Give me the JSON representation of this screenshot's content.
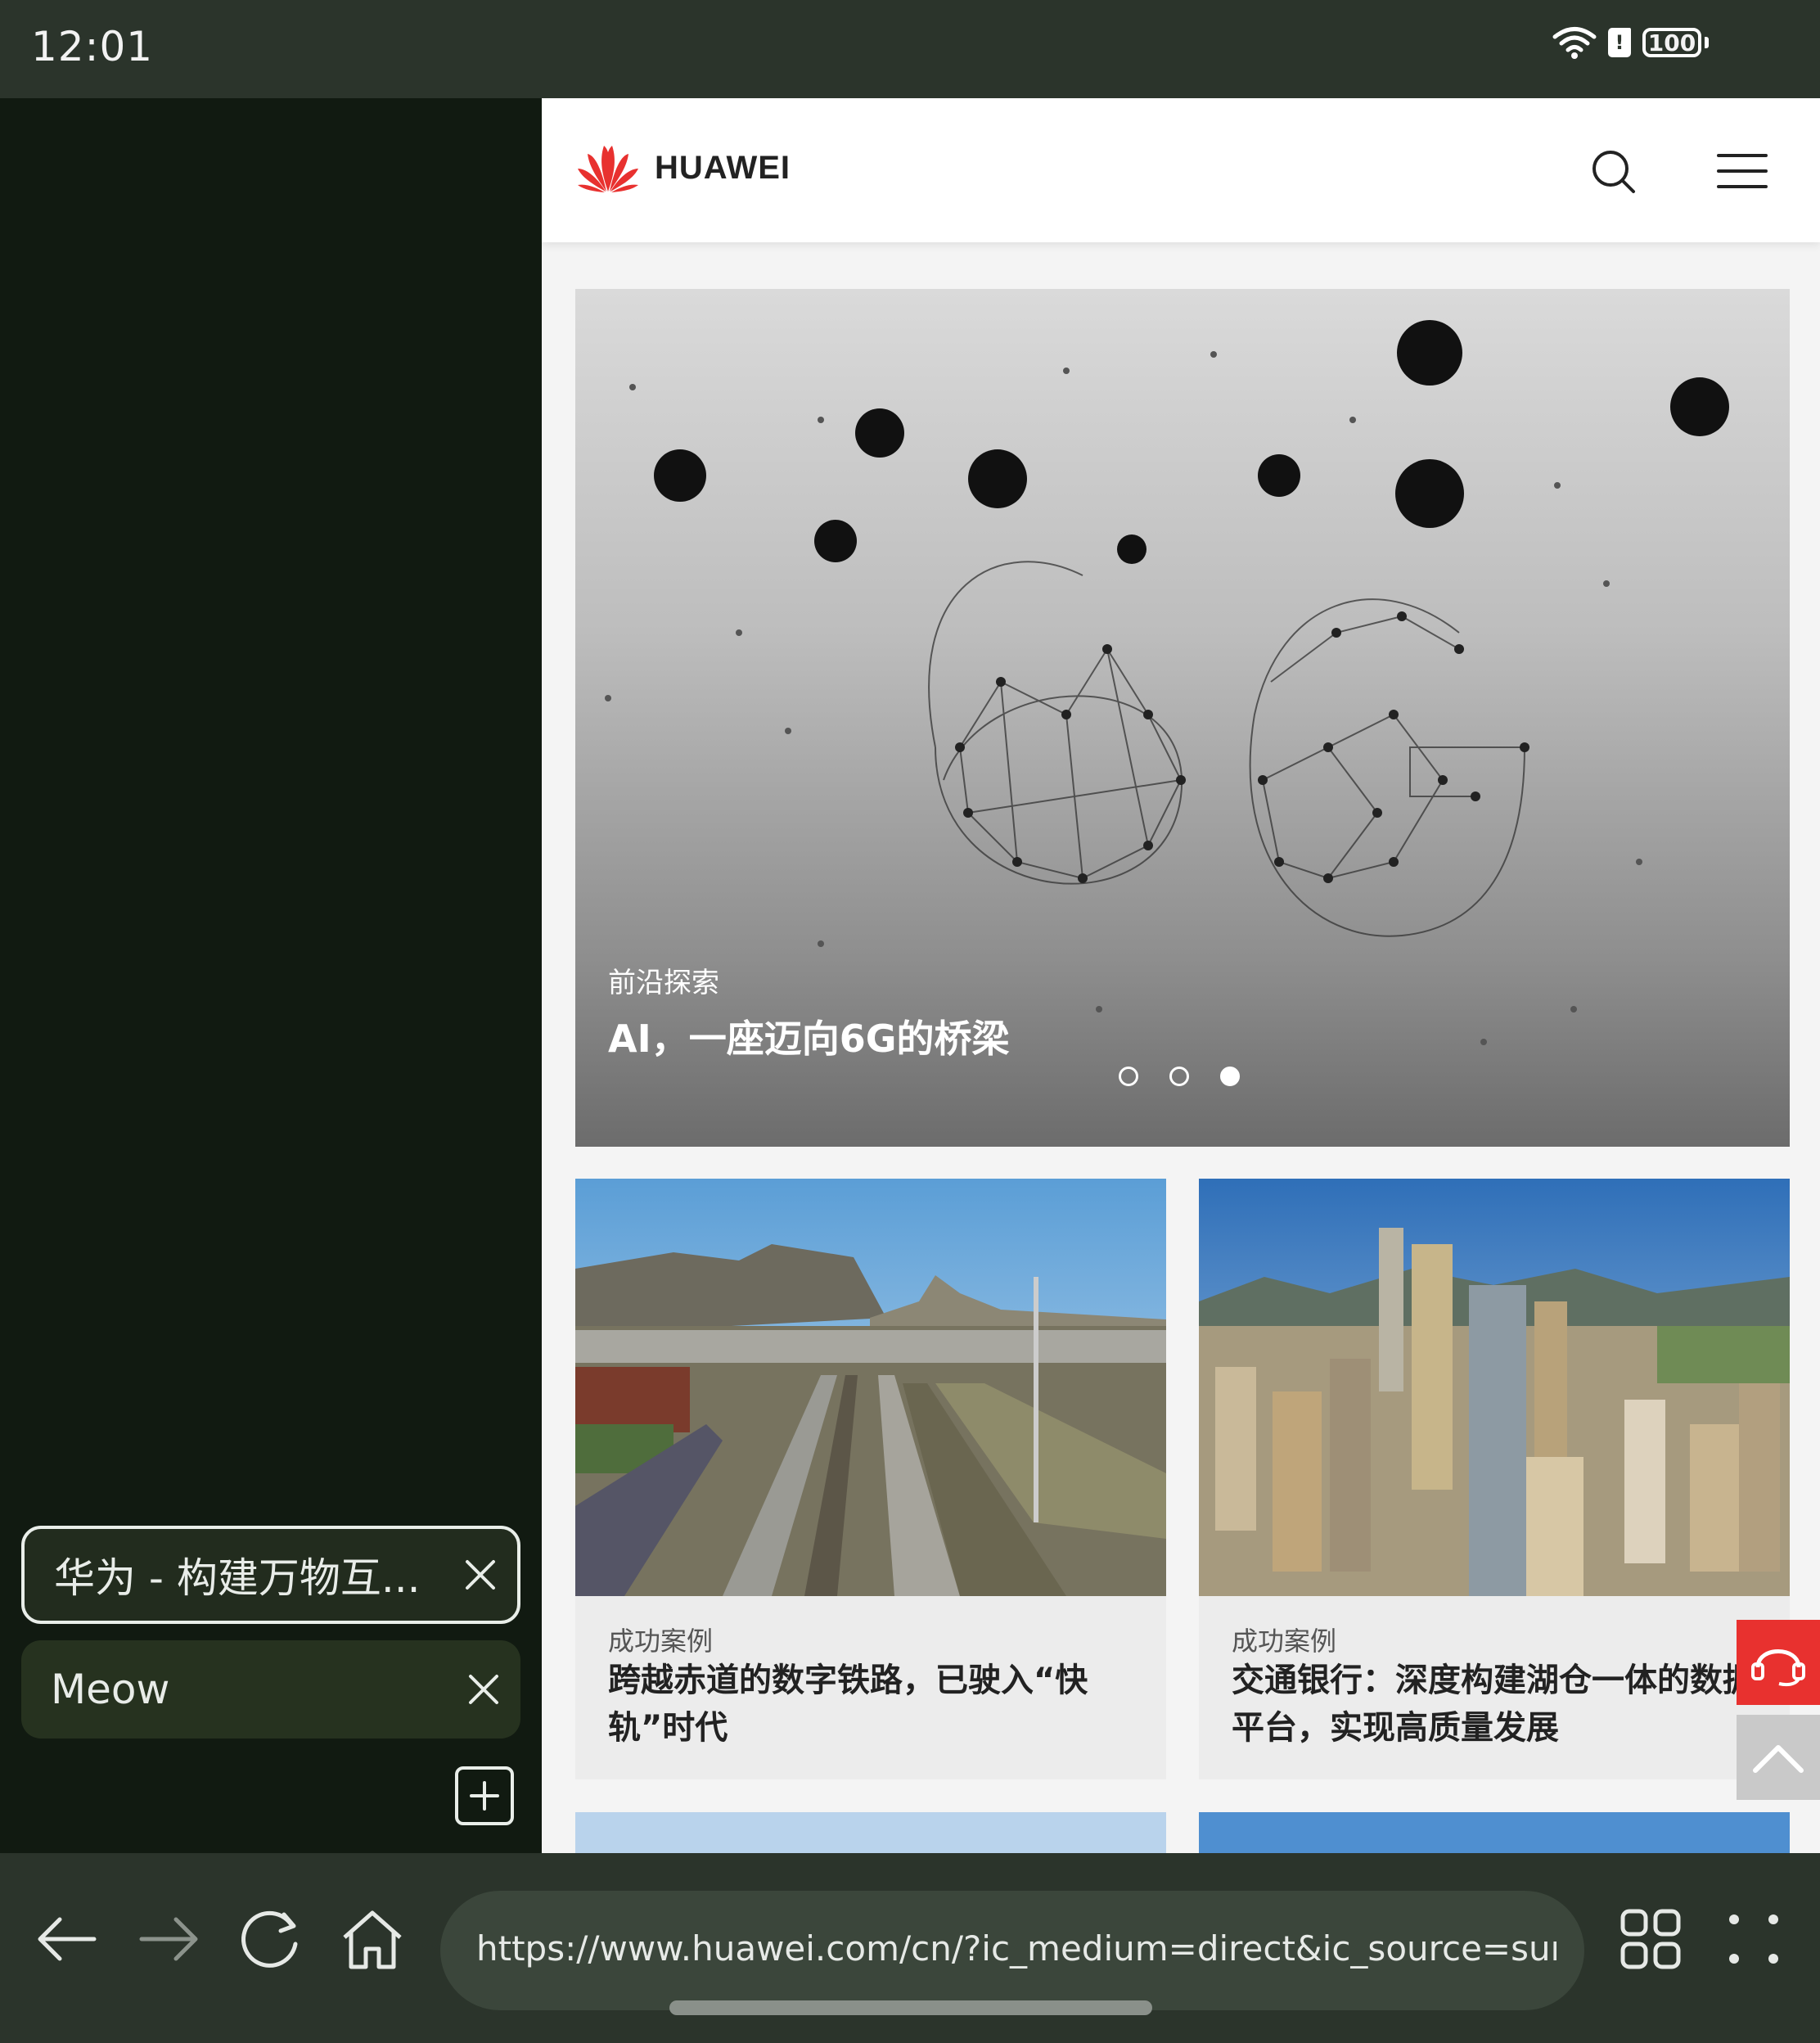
{
  "status_bar": {
    "time": "12:01",
    "battery": "100",
    "icons": [
      "wifi-icon",
      "sd-card-icon",
      "battery-icon"
    ]
  },
  "tabs": [
    {
      "title": "华为 - 构建万物互...",
      "active": true
    },
    {
      "title": "Meow",
      "active": false
    }
  ],
  "header": {
    "brand": "HUAWEI"
  },
  "hero": {
    "category": "前沿探索",
    "title": "AI，一座迈向6G的桥梁",
    "active_slide": 3,
    "slide_count": 3
  },
  "cards": [
    {
      "category": "成功案例",
      "title": "跨越赤道的数字铁路，已驶入“快轨”时代"
    },
    {
      "category": "成功案例",
      "title": "交通银行：深度构建湖仓一体的数据平台，实现高质量发展"
    }
  ],
  "toolbar": {
    "url": "https://www.huawei.com/cn/?ic_medium=direct&ic_source=surlent"
  },
  "colors": {
    "brand_red": "#e8312f",
    "panel_dark": "#111a11",
    "toolbar": "#2b342b"
  }
}
